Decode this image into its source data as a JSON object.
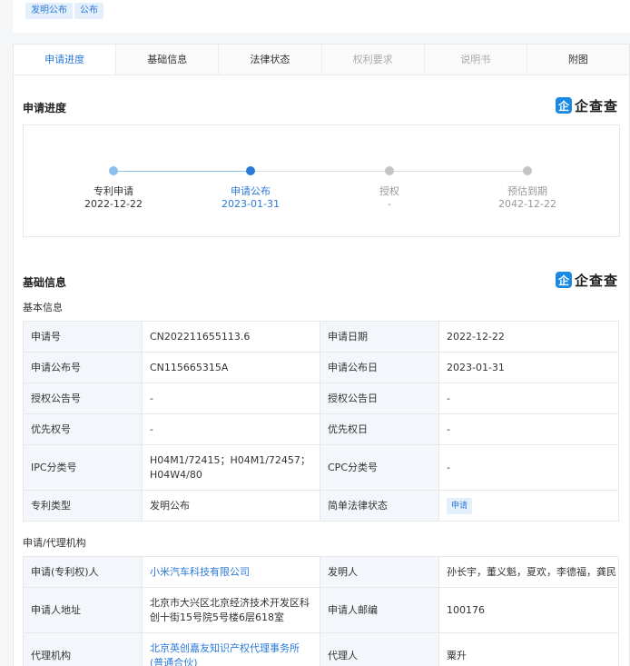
{
  "tags": [
    "发明公布",
    "公布"
  ],
  "tabs": [
    {
      "label": "申请进度",
      "state": "active"
    },
    {
      "label": "基础信息",
      "state": "normal"
    },
    {
      "label": "法律状态",
      "state": "normal"
    },
    {
      "label": "权利要求",
      "state": "disabled"
    },
    {
      "label": "说明书",
      "state": "disabled"
    },
    {
      "label": "附图",
      "state": "normal"
    }
  ],
  "logo": {
    "badge": "企",
    "text": "企查查"
  },
  "progress": {
    "title": "申请进度",
    "steps": [
      {
        "name": "专利申请",
        "date": "2022-12-22",
        "state": "done"
      },
      {
        "name": "申请公布",
        "date": "2023-01-31",
        "state": "current"
      },
      {
        "name": "授权",
        "date": "-",
        "state": "pending"
      },
      {
        "name": "预估到期",
        "date": "2042-12-22",
        "state": "pending"
      }
    ]
  },
  "basic": {
    "title": "基础信息",
    "subtitle": "基本信息",
    "rows": [
      [
        "申请号",
        "CN202211655113.6",
        "申请日期",
        "2022-12-22"
      ],
      [
        "申请公布号",
        "CN115665315A",
        "申请公布日",
        "2023-01-31"
      ],
      [
        "授权公告号",
        "-",
        "授权公告日",
        "-"
      ],
      [
        "优先权号",
        "-",
        "优先权日",
        "-"
      ],
      [
        "IPC分类号",
        "H04M1/72415；H04M1/72457；H04W4/80",
        "CPC分类号",
        "-"
      ],
      [
        "专利类型",
        "发明公布",
        "简单法律状态",
        "申请"
      ]
    ]
  },
  "agency": {
    "subtitle": "申请/代理机构",
    "rows": [
      [
        "申请(专利权)人",
        "小米汽车科技有限公司",
        "发明人",
        "孙长宇，董义魁，夏欢，李德福，龚民"
      ],
      [
        "申请人地址",
        "北京市大兴区北京经济技术开发区科创十街15号院5号楼6层618室",
        "申请人邮编",
        "100176"
      ],
      [
        "代理机构",
        "北京英创嘉友知识产权代理事务所(普通合伙)",
        "代理人",
        "粟升"
      ]
    ]
  },
  "colors": {
    "accent": "#2c79d8",
    "done": "#8cc0ec",
    "current": "#2c79d8",
    "pending": "#c4c4c4"
  }
}
